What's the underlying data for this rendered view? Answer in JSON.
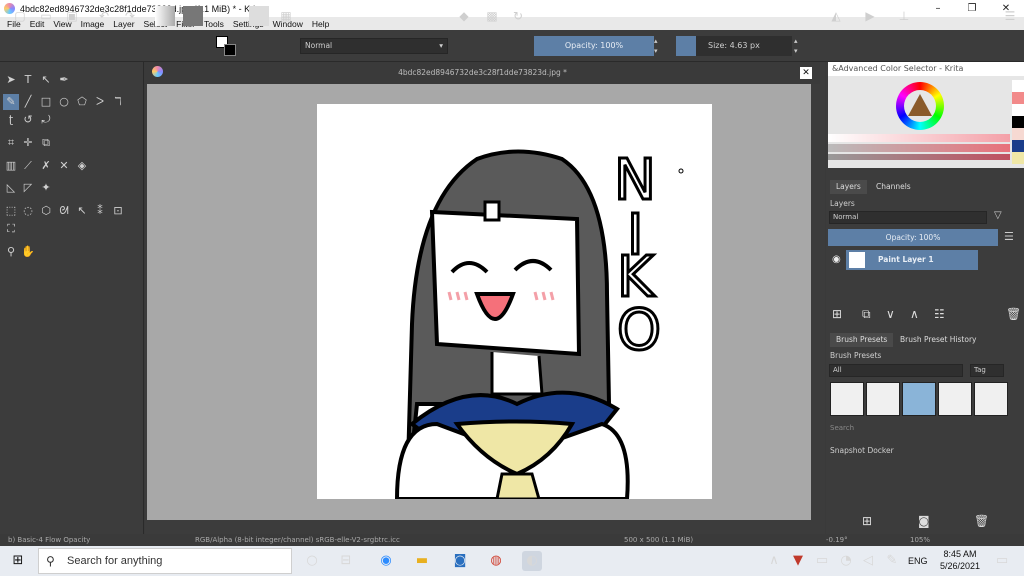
{
  "window": {
    "title": "4bdc82ed8946732de3c28f1dde73823d.jpg (1.1 MiB)  * - Krita",
    "minimize": "–",
    "restore": "❐",
    "close": "✕"
  },
  "menu": [
    "File",
    "Edit",
    "View",
    "Image",
    "Layer",
    "Select",
    "Filter",
    "Tools",
    "Settings",
    "Window",
    "Help"
  ],
  "toolbar": {
    "blend_mode": "Normal",
    "opacity": "Opacity: 100%",
    "size": "Size: 4.63 px"
  },
  "document": {
    "tab_title": "4bdc82ed8946732de3c28f1dde73823d.jpg *"
  },
  "drawing": {
    "letters": [
      "N",
      "I",
      "K",
      "O"
    ]
  },
  "color_selector": {
    "title": "&Advanced Color Selector - Krita"
  },
  "layers_panel": {
    "tabs": [
      "Layers",
      "Channels"
    ],
    "title": "Layers",
    "blend_mode": "Normal",
    "opacity": "Opacity:  100%",
    "layer_name": "Paint Layer 1"
  },
  "brush_panel": {
    "tabs": [
      "Brush Presets",
      "Brush Preset History"
    ],
    "title": "Brush Presets",
    "filter": "All",
    "tag": "Tag",
    "search_placeholder": "Search"
  },
  "snapshot": {
    "title": "Snapshot Docker"
  },
  "statusbar": {
    "brush": "b) Basic-4 Flow Opacity",
    "colorspace": "RGB/Alpha (8-bit integer/channel)  sRGB-elle-V2-srgbtrc.icc",
    "dimensions": "500 x 500 (1.1 MiB)",
    "rotation": "-0.19°",
    "zoom": "105%"
  },
  "taskbar": {
    "search_placeholder": "Search for anything",
    "language": "ENG",
    "time": "8:45 AM",
    "date": "5/26/2021"
  }
}
